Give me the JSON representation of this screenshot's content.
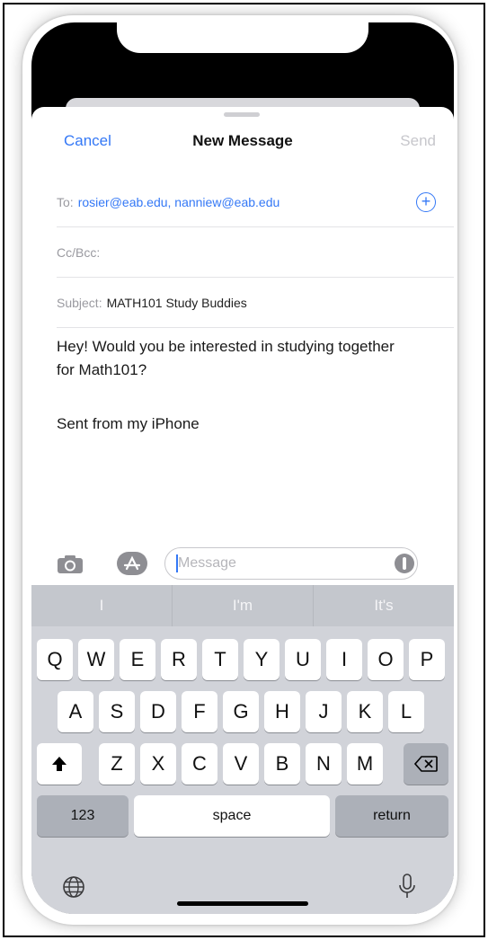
{
  "nav": {
    "cancel": "Cancel",
    "title": "New Message",
    "send": "Send"
  },
  "to": {
    "label": "To:",
    "value": "rosier@eab.edu, nanniew@eab.edu"
  },
  "cc": {
    "label": "Cc/Bcc:"
  },
  "subject": {
    "label": "Subject:",
    "value": "MATH101 Study Buddies"
  },
  "body": {
    "text": "Hey! Would you be interested in studying together for Math101?",
    "signature": "Sent from my iPhone"
  },
  "compose": {
    "placeholder": "Message"
  },
  "suggestions": [
    "I",
    "I'm",
    "It's"
  ],
  "keys": {
    "row1": [
      "Q",
      "W",
      "E",
      "R",
      "T",
      "Y",
      "U",
      "I",
      "O",
      "P"
    ],
    "row2": [
      "A",
      "S",
      "D",
      "F",
      "G",
      "H",
      "J",
      "K",
      "L"
    ],
    "row3": [
      "Z",
      "X",
      "C",
      "V",
      "B",
      "N",
      "M"
    ],
    "numbers": "123",
    "space": "space",
    "return": "return"
  },
  "icons": {
    "add_recipient": "plus-circle-icon",
    "camera": "camera-icon",
    "apps": "app-store-icon",
    "audio": "audio-record-icon",
    "shift": "shift-icon",
    "backspace": "backspace-icon",
    "globe": "globe-icon",
    "dictation": "microphone-icon"
  },
  "colors": {
    "accent": "#3478f6",
    "keyboard_bg": "#d1d3d9",
    "key_bg": "#ffffff",
    "fn_key_bg": "#acb0b8"
  }
}
